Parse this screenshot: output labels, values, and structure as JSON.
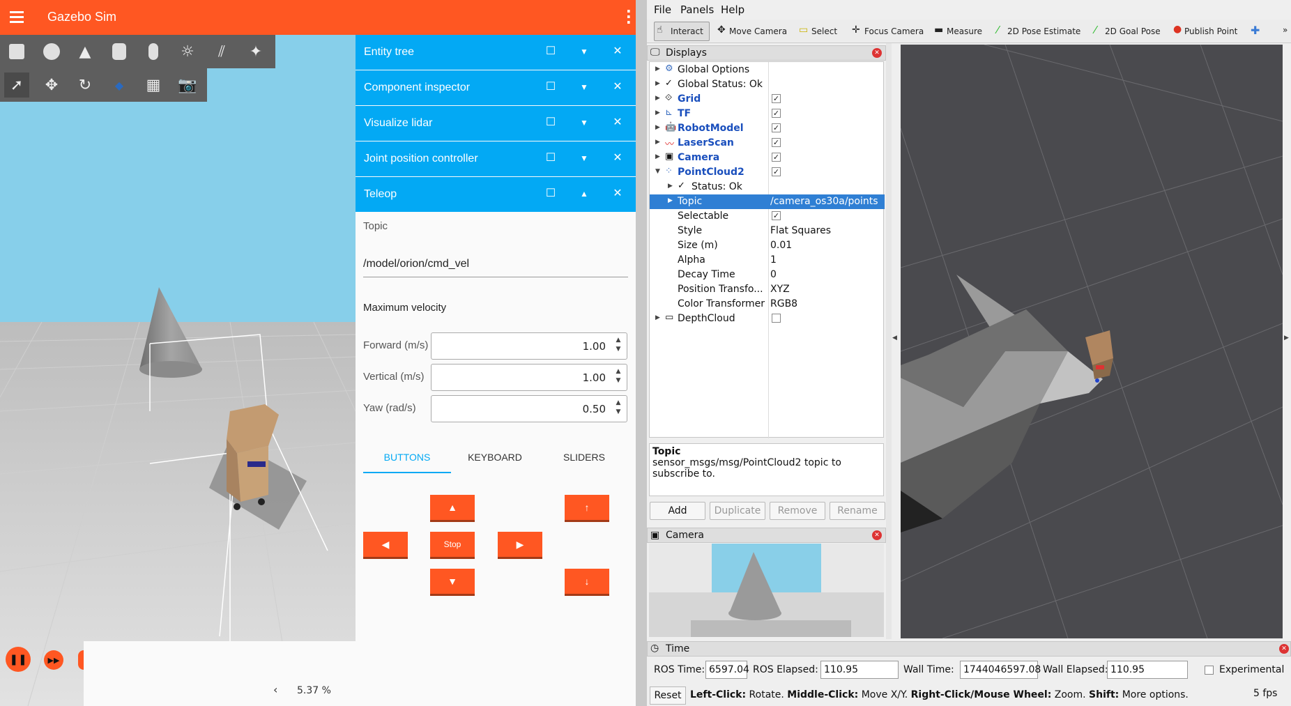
{
  "gazebo": {
    "title": "Gazebo Sim",
    "panels": [
      {
        "label": "Entity tree"
      },
      {
        "label": "Component inspector"
      },
      {
        "label": "Visualize lidar"
      },
      {
        "label": "Joint position controller"
      },
      {
        "label": "Teleop"
      }
    ],
    "teleop": {
      "topic_label": "Topic",
      "topic_value": "/model/orion/cmd_vel",
      "max_vel_label": "Maximum velocity",
      "forward_label": "Forward (m/s)",
      "forward_value": "1.00",
      "vertical_label": "Vertical (m/s)",
      "vertical_value": "1.00",
      "yaw_label": "Yaw (rad/s)",
      "yaw_value": "0.50",
      "tabs": [
        "BUTTONS",
        "KEYBOARD",
        "SLIDERS"
      ],
      "up": "▲",
      "down": "▼",
      "left": "◀",
      "right": "▶",
      "stop": "Stop",
      "v_up": "↑",
      "v_down": "↓"
    },
    "rtf": "5.37 %",
    "rtf_arrow": "‹"
  },
  "rviz": {
    "menu": [
      "File",
      "Panels",
      "Help"
    ],
    "tools": [
      "Interact",
      "Move Camera",
      "Select",
      "Focus Camera",
      "Measure",
      "2D Pose Estimate",
      "2D Goal Pose",
      "Publish Point"
    ],
    "displays_title": "Displays",
    "displays": [
      {
        "name": "Global Options"
      },
      {
        "name": "Global Status: Ok"
      },
      {
        "name": "Grid"
      },
      {
        "name": "TF"
      },
      {
        "name": "RobotModel"
      },
      {
        "name": "LaserScan"
      },
      {
        "name": "Camera"
      },
      {
        "name": "PointCloud2"
      },
      {
        "name": "Status: Ok"
      },
      {
        "name": "Topic",
        "value": "/camera_os30a/points"
      },
      {
        "name": "Selectable"
      },
      {
        "name": "Style",
        "value": "Flat Squares"
      },
      {
        "name": "Size (m)",
        "value": "0.01"
      },
      {
        "name": "Alpha",
        "value": "1"
      },
      {
        "name": "Decay Time",
        "value": "0"
      },
      {
        "name": "Position Transfo...",
        "value": "XYZ"
      },
      {
        "name": "Color Transformer",
        "value": "RGB8"
      },
      {
        "name": "DepthCloud"
      }
    ],
    "desc_title": "Topic",
    "desc_text": "sensor_msgs/msg/PointCloud2 topic to subscribe to.",
    "buttons": [
      "Add",
      "Duplicate",
      "Remove",
      "Rename"
    ],
    "camera_title": "Camera",
    "time_title": "Time",
    "ros_time_label": "ROS Time:",
    "ros_time": "6597.04",
    "ros_elapsed_label": "ROS Elapsed:",
    "ros_elapsed": "110.95",
    "wall_time_label": "Wall Time:",
    "wall_time": "1744046597.08",
    "wall_elapsed_label": "Wall Elapsed:",
    "wall_elapsed": "110.95",
    "experimental": "Experimental",
    "reset": "Reset",
    "help": [
      {
        "b": "Left-Click:",
        "t": " Rotate. "
      },
      {
        "b": "Middle-Click:",
        "t": " Move X/Y. "
      },
      {
        "b": "Right-Click/Mouse Wheel:",
        "t": " Zoom. "
      },
      {
        "b": "Shift:",
        "t": " More options."
      }
    ],
    "fps": "5 fps"
  }
}
